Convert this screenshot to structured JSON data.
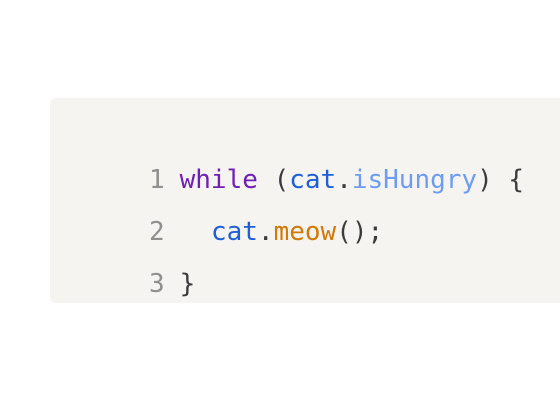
{
  "code": {
    "line1": {
      "number": "1",
      "keyword": "while",
      "space": " ",
      "open_paren": "(",
      "object": "cat",
      "dot": ".",
      "property": "isHungry",
      "close_paren": ")",
      "brace": " {"
    },
    "line2": {
      "number": "2",
      "indent": "  ",
      "object": "cat",
      "dot": ".",
      "method": "meow",
      "call": "();"
    },
    "line3": {
      "number": "3",
      "brace": "}"
    }
  },
  "colors": {
    "keyword": "#6f1fb4",
    "variable": "#1f5fd6",
    "property": "#6e9cf0",
    "method": "#d27a05",
    "punctuation": "#3b3b3b",
    "line_number": "#8f8f8f",
    "background": "#f5f4f1"
  }
}
